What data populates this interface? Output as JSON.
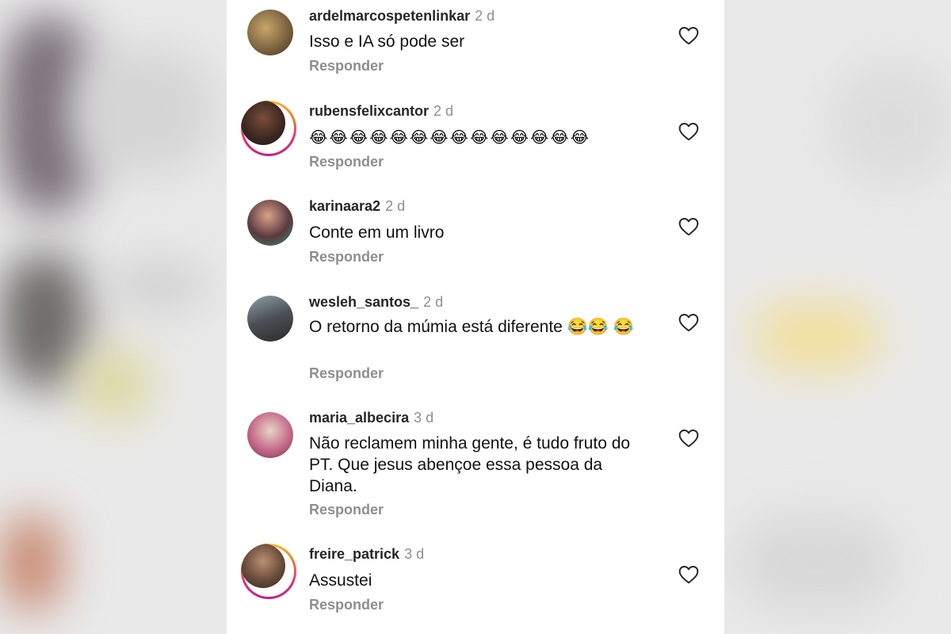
{
  "comments": [
    {
      "username": "ardelmarcospetenlinkar",
      "time": "2 d",
      "text": "Isso e IA só pode ser",
      "reply": "Responder",
      "avatar": "avatar-photo",
      "story": false
    },
    {
      "username": "rubensfelixcantor",
      "time": "2 d",
      "text": "😂😂😂😂😂😂😂😂😂😂😂😂😂😂",
      "reply": "Responder",
      "avatar": "avatar-photo",
      "story": true
    },
    {
      "username": "karinaara2",
      "time": "2 d",
      "text": "Conte em um livro",
      "reply": "Responder",
      "avatar": "avatar-photo",
      "story": false
    },
    {
      "username": "wesleh_santos_",
      "time": "2 d",
      "text": "O retorno da múmia está diferente 😂😂 😂",
      "reply": "Responder",
      "avatar": "avatar-photo",
      "story": false
    },
    {
      "username": "maria_albecira",
      "time": "3 d",
      "text": "Não reclamem minha gente, é tudo fruto do PT. Que jesus abençoe essa pessoa da Diana.",
      "reply": "Responder",
      "avatar": "avatar-photo",
      "story": false
    },
    {
      "username": "freire_patrick",
      "time": "3 d",
      "text": "Assustei",
      "reply": "Responder",
      "avatar": "avatar-photo",
      "story": true
    }
  ],
  "icons": {
    "like": "heart-outline-icon"
  },
  "colors": {
    "username": "#262626",
    "secondary": "#8e8e8e",
    "story_ring": "#dd2a7b"
  }
}
